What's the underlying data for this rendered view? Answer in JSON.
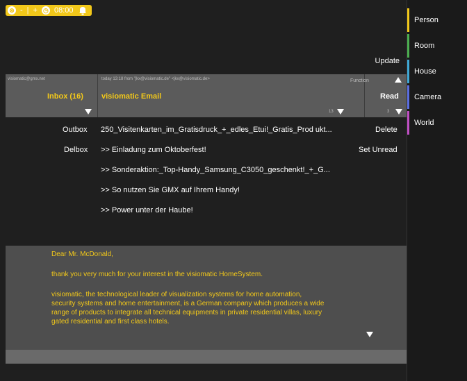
{
  "status_bar": {
    "close_symbol": "⊗",
    "minus": "-",
    "plus": "+",
    "clock_icon": "clock-icon",
    "time": "08:00",
    "bell_icon": "bell-icon"
  },
  "sidebar": {
    "items": [
      {
        "label": "Person",
        "accent": "#f2c81a"
      },
      {
        "label": "Room",
        "accent": "#4caf50"
      },
      {
        "label": "House",
        "accent": "#3fa9d6"
      },
      {
        "label": "Camera",
        "accent": "#5b6ee1"
      },
      {
        "label": "World",
        "accent": "#c04fc4"
      }
    ]
  },
  "toolbar": {
    "update_label": "Update"
  },
  "header": {
    "account": "visiomatic@gmx.net",
    "folder_title": "Inbox (16)",
    "meta": "today 13:18 from \"jkx@visiomatic.de\" <jkx@visiomatic.de>",
    "subject": "visiomatic Email",
    "function_label": "Function",
    "action": "Read",
    "message_count": "13",
    "action_count": "3"
  },
  "folders": [
    "Outbox",
    "Delbox"
  ],
  "messages": [
    "250_Visitenkarten_im_Gratisdruck_+_edles_Etui!_Gratis_Prod ukt...",
    ">> Einladung zum Oktoberfest!",
    ">> Sonderaktion:_Top-Handy_Samsung_C3050_geschenkt!_+_G...",
    ">> So nutzen Sie GMX auf Ihrem Handy!",
    ">> Power unter der Haube!"
  ],
  "actions": [
    "Delete",
    "Set Unread"
  ],
  "body": {
    "greeting": "Dear Mr. McDonald,",
    "para1": "thank you very much for your interest in the visiomatic HomeSystem.",
    "para2_lines": [
      "visiomatic, the technological leader of visualization systems for home automation,",
      "security systems and home entertainment, is a German company which produces a wide",
      "range of products to integrate all technical equipments in private residential villas, luxury",
      "gated residential and first class hotels."
    ]
  }
}
